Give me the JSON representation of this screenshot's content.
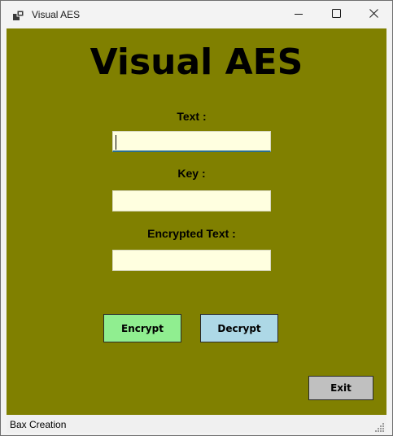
{
  "window": {
    "title": "Visual AES",
    "icon": "app-window-icon",
    "controls": [
      "minimize-icon",
      "maximize-icon",
      "close-icon"
    ]
  },
  "form": {
    "heading": "Visual AES",
    "background_color": "#808000",
    "text_label": "Text :",
    "text_value": "",
    "key_label": "Key :",
    "key_value": "",
    "encrypted_label": "Encrypted Text :",
    "encrypted_value": "",
    "field_color": "#ffffe0"
  },
  "buttons": {
    "encrypt": {
      "label": "Encrypt",
      "color": "#90ee90"
    },
    "decrypt": {
      "label": "Decrypt",
      "color": "#add8e6"
    },
    "exit": {
      "label": "Exit",
      "color": "#c0c0c0"
    }
  },
  "statusbar": {
    "text": "Bax Creation",
    "grip_icon": "resize-grip-icon"
  }
}
